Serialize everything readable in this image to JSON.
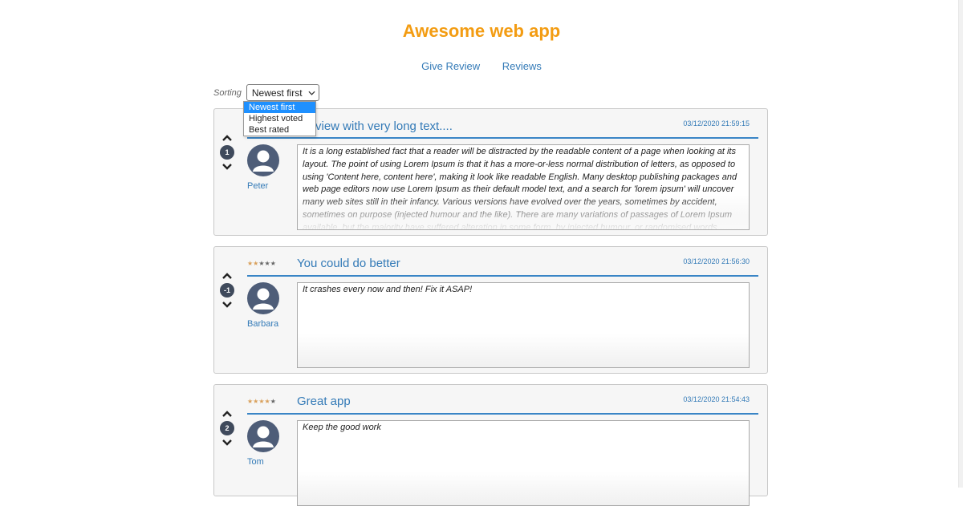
{
  "app": {
    "title": "Awesome web app"
  },
  "nav": {
    "give_review": "Give Review",
    "reviews": "Reviews"
  },
  "sorting": {
    "label": "Sorting",
    "selected": "Newest first",
    "options": [
      "Newest first",
      "Highest voted",
      "Best rated"
    ]
  },
  "reviews": [
    {
      "title": "view with very long text....",
      "date": "03/12/2020 21:59:15",
      "votes": "1",
      "user": "Peter",
      "rating": 5,
      "body": "It is a long established fact that a reader will be distracted by the readable content of a page when looking at its layout. The point of using Lorem Ipsum is that it has a more-or-less normal distribution of letters, as opposed to using 'Content here, content here', making it look like readable English. Many desktop publishing packages and web page editors now use Lorem Ipsum as their default model text, and a search for 'lorem ipsum' will uncover many web sites still in their infancy. Various versions have evolved over the years, sometimes by accident, sometimes on purpose (injected humour and the like). There are many variations of passages of Lorem Ipsum available, but the majority have suffered alteration in some form, by injected humour, or randomised words"
    },
    {
      "title": "You could do better",
      "date": "03/12/2020 21:56:30",
      "votes": "-1",
      "user": "Barbara",
      "rating": 2,
      "body": "It crashes every now and then! Fix it ASAP!"
    },
    {
      "title": "Great app",
      "date": "03/12/2020 21:54:43",
      "votes": "2",
      "user": "Tom",
      "rating": 4,
      "body": "Keep the good work"
    }
  ],
  "colors": {
    "accent": "#f39c12",
    "link": "#337ab7",
    "star_on": "#d9a05b",
    "star_off": "#666666"
  },
  "icons": {
    "upvote": "chevron-up-icon",
    "downvote": "chevron-down-icon",
    "avatar": "user-avatar-icon"
  }
}
